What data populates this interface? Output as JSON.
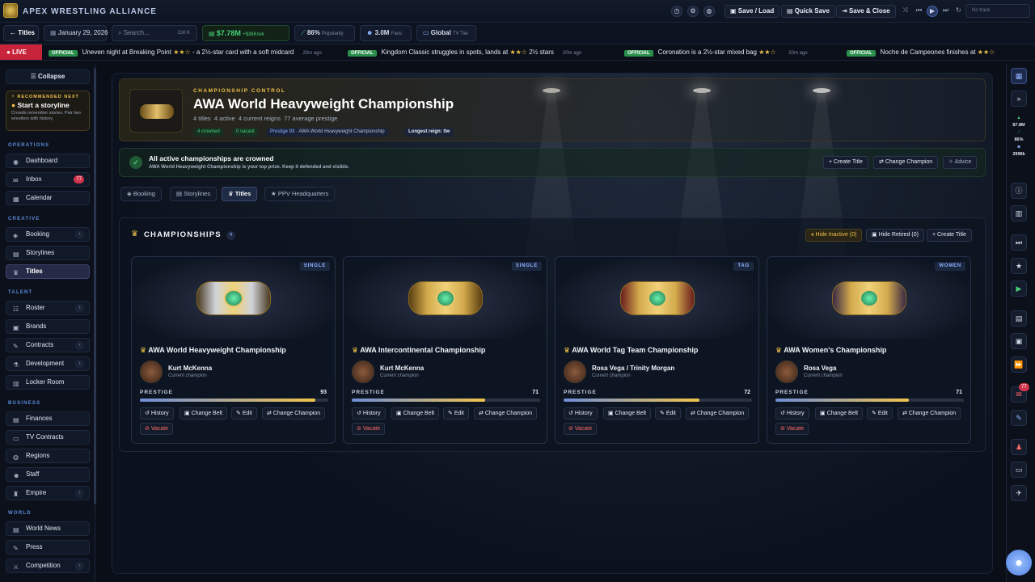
{
  "app": {
    "name": "APEX WRESTLING ALLIANCE"
  },
  "topbar": {
    "save_load": "Save / Load",
    "quick_save": "Quick Save",
    "save_close": "Save & Close",
    "track": "No track"
  },
  "subbar": {
    "back": "Titles",
    "date": "January 29, 2026",
    "search_placeholder": "Search...",
    "search_shortcut": "Ctrl K",
    "money": "$7.78M",
    "money_delta": "+$36K/wk",
    "popularity": "86%",
    "popularity_label": "Popularity",
    "fans": "3.0M",
    "fans_label": "Fans",
    "tv_tier": "Global",
    "tv_tier_label": "TV Tier"
  },
  "ticker": {
    "live": "LIVE",
    "badge": "OFFICIAL",
    "items": [
      {
        "text": "Uneven night at Breaking Point",
        "stars": "★★☆",
        "rest": "- a 2½-star card with a soft midcard",
        "time": "20m ago"
      },
      {
        "text": "Kingdom Classic struggles in spots, lands at",
        "stars": "★★☆",
        "rest": "2½ stars",
        "time": "20m ago"
      },
      {
        "text": "Coronation is a 2½-star mixed bag",
        "stars": "★★☆",
        "rest": "",
        "time": "20m ago"
      },
      {
        "text": "Noche de Campeones finishes at",
        "stars": "★★☆",
        "rest": "",
        "time": ""
      }
    ]
  },
  "sidebar": {
    "collapse": "Collapse",
    "recommended_label": "RECOMMENDED NEXT",
    "recommended_title": "Start a storyline",
    "recommended_desc": "Crowds remember stories. Pair two wrestlers with history.",
    "sections": {
      "operations": "OPERATIONS",
      "creative": "CREATIVE",
      "talent": "TALENT",
      "business": "BUSINESS",
      "world": "WORLD"
    },
    "items": {
      "dashboard": "Dashboard",
      "inbox": "Inbox",
      "inbox_badge": "77",
      "calendar": "Calendar",
      "booking": "Booking",
      "storylines": "Storylines",
      "titles": "Titles",
      "roster": "Roster",
      "brands": "Brands",
      "contracts": "Contracts",
      "development": "Development",
      "locker_room": "Locker Room",
      "finances": "Finances",
      "tv_contracts": "TV Contracts",
      "regions": "Regions",
      "staff": "Staff",
      "empire": "Empire",
      "world_news": "World News",
      "press": "Press",
      "competition": "Competition"
    }
  },
  "header": {
    "kicker": "CHAMPIONSHIP CONTROL",
    "title": "AWA World Heavyweight Championship",
    "stats": "4 titles  4 active  4 current reigns  77 average prestige",
    "chip_crowned": "4 crowned",
    "chip_vacant": "0 vacant",
    "chip_prestige": "Prestige 93",
    "chip_title": "AWA World Heavyweight Championship",
    "chip_reign": "Longest reign: 0w"
  },
  "status": {
    "title": "All active championships are crowned",
    "desc": "AWA World Heavyweight Championship is your top prize. Keep it defended and visible.",
    "create_title": "Create Title",
    "change_champion": "Change Champion",
    "advice": "Advice"
  },
  "tabs": [
    "Booking",
    "Storylines",
    "Titles",
    "PPV Headquarters"
  ],
  "championships": {
    "heading": "CHAMPIONSHIPS",
    "count": "4",
    "hide_inactive": "Hide Inactive (0)",
    "hide_retired": "Hide Retired (0)",
    "create_title": "Create Title",
    "prestige_label": "PRESTIGE",
    "current_champion": "Current champion",
    "actions": {
      "history": "History",
      "change_belt": "Change Belt",
      "edit": "Edit",
      "change_champion": "Change Champion",
      "vacate": "Vacate"
    },
    "cards": [
      {
        "tag": "SINGLE",
        "name": "AWA World Heavyweight Championship",
        "champion": "Kurt McKenna",
        "prestige": 93
      },
      {
        "tag": "SINGLE",
        "name": "AWA Intercontinental Championship",
        "champion": "Kurt McKenna",
        "prestige": 71
      },
      {
        "tag": "TAG",
        "name": "AWA World Tag Team Championship",
        "champion": "Rosa Vega / Trinity Morgan",
        "prestige": 72
      },
      {
        "tag": "WOMEN",
        "name": "AWA Women's Championship",
        "champion": "Rosa Vega",
        "prestige": 71
      }
    ]
  },
  "rightrail": {
    "money": "$7.8M",
    "pop": "86%",
    "fans": "2998k",
    "badge": "77"
  },
  "colors": {
    "accent": "#f0c24a",
    "live": "#c8243a",
    "official": "#2a8f4b",
    "positive": "#46d17a"
  }
}
